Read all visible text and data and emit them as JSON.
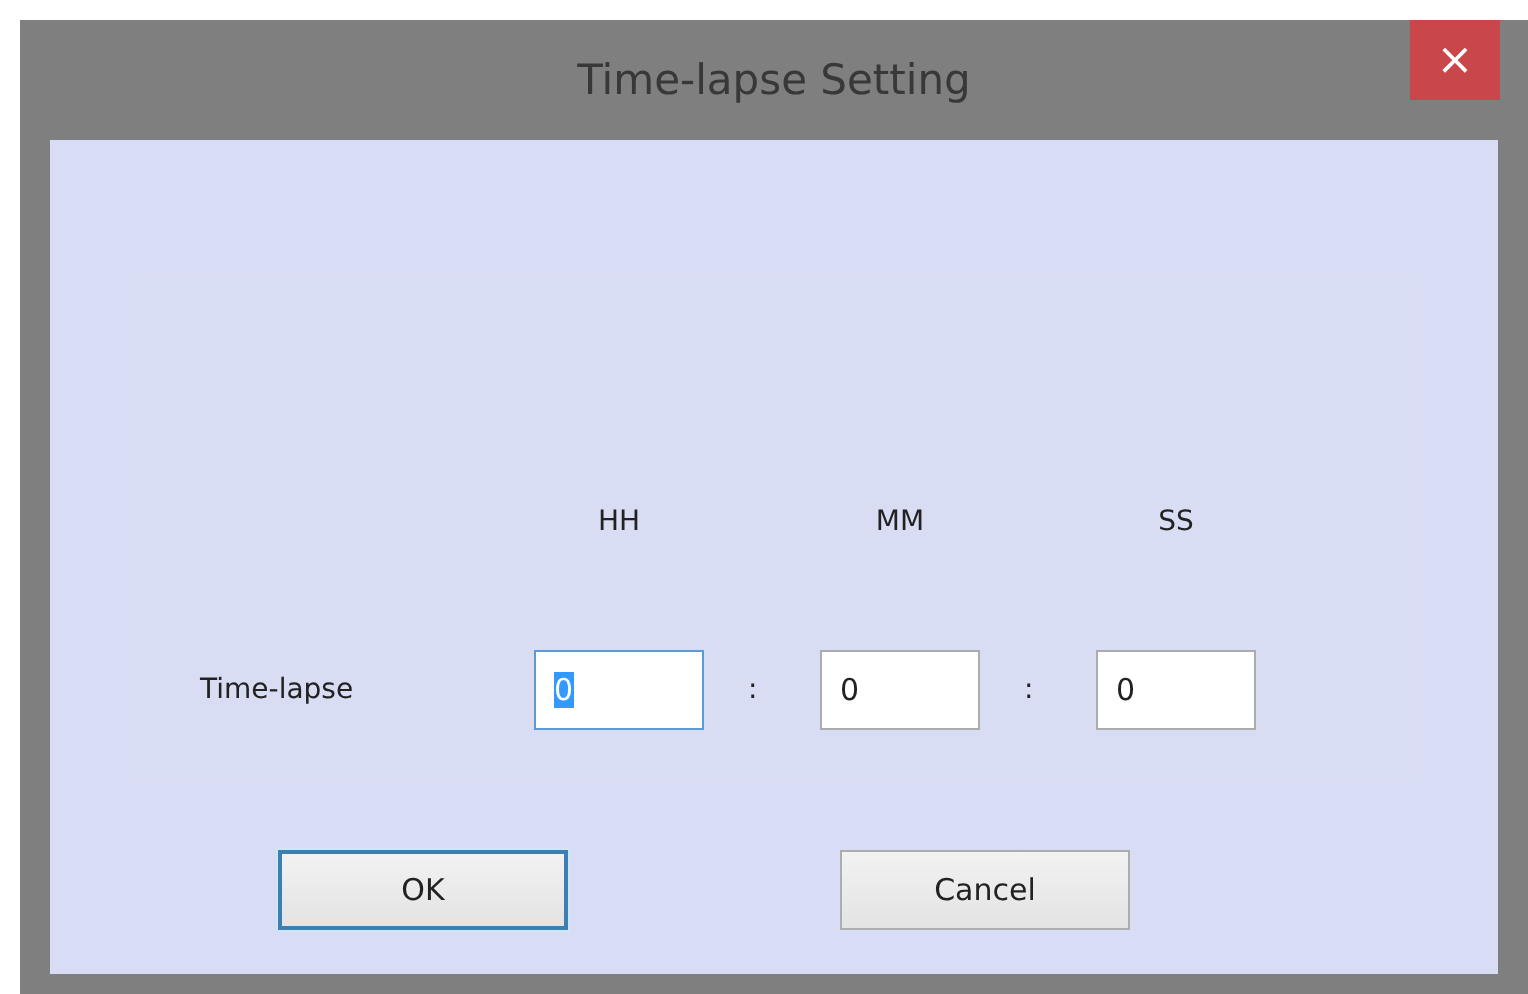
{
  "window": {
    "title": "Time-lapse Setting",
    "close_button": "×"
  },
  "column_headers": [
    "HH",
    "MM",
    "SS"
  ],
  "row_label": "Time-lapse",
  "fields": [
    {
      "value": "0",
      "focused": true
    },
    {
      "value": "0",
      "focused": false
    },
    {
      "value": "0",
      "focused": false
    }
  ],
  "separators": [
    ":",
    ":"
  ],
  "buttons": [
    {
      "label": "OK",
      "default": true
    },
    {
      "label": "Cancel",
      "default": false
    }
  ]
}
